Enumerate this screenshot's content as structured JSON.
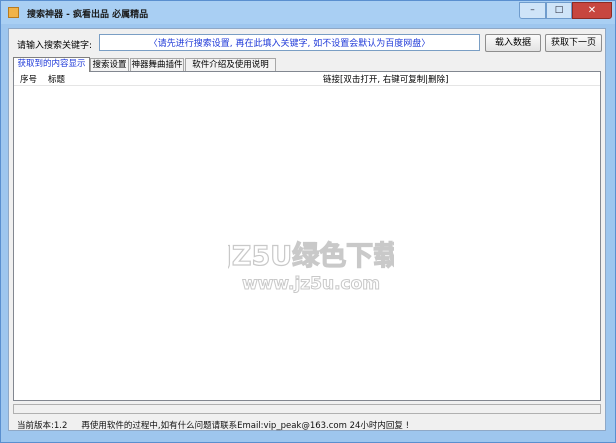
{
  "window": {
    "title": "搜索神器 - 疯看出品 必属精品",
    "controls": {
      "minimize": "–",
      "maximize": "□",
      "close": "✕"
    }
  },
  "search": {
    "label": "请输入搜索关键字:",
    "value": "〈请先进行搜索设置, 再在此填入关键字, 如不设置会默认为百度网盘〉",
    "load_button": "载入数据",
    "next_button": "获取下一页"
  },
  "tabs": [
    {
      "label": "获取到的内容显示",
      "active": true
    },
    {
      "label": "搜索设置",
      "active": false
    },
    {
      "label": "神器舞曲插件",
      "active": false
    },
    {
      "label": "软件介绍及使用说明",
      "active": false
    }
  ],
  "results": {
    "columns": [
      "序号",
      "标题",
      "链接[双击打开, 右键可复制|删除]"
    ],
    "rows": []
  },
  "watermark": {
    "brand": "JZ5U绿色下载",
    "url": "www.jz5u.com"
  },
  "status": {
    "version": "当前版本:1.2",
    "message": "再使用软件的过程中,如有什么问题请联系Email:vip_peak@163.com 24小时内回复 !"
  },
  "colors": {
    "accent_text": "#1f39d8",
    "titlebar": "#a9cff3",
    "close_button": "#c7463f"
  }
}
